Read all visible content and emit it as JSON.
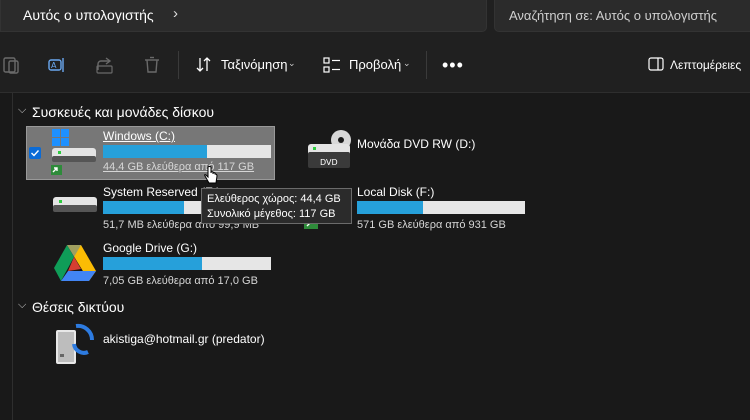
{
  "address": {
    "breadcrumb": "Αυτός ο υπολογιστής",
    "chevron": "›"
  },
  "search": {
    "placeholder": "Αναζήτηση σε: Αυτός ο υπολογιστής"
  },
  "toolbar": {
    "sort_label": "Ταξινόμηση",
    "view_label": "Προβολή",
    "more_label": "•••",
    "details_label": "Λεπτομέρειες"
  },
  "groups": {
    "devices": "Συσκευές και μονάδες δίσκου",
    "network": "Θέσεις δικτύου"
  },
  "drives": [
    {
      "name": "Windows (C:)",
      "info": "44,4 GB ελεύθερα από 117 GB",
      "used_fraction": 0.62,
      "selected": true
    },
    {
      "name": "System Reserved (E:)",
      "info": "51,7 MB ελεύθερα από 99,9 MB",
      "used_fraction": 0.48
    },
    {
      "name": "Google Drive (G:)",
      "info": "7,05 GB ελεύθερα από 17,0 GB",
      "used_fraction": 0.59
    },
    {
      "name": "Μονάδα DVD RW (D:)"
    },
    {
      "name": "Local Disk (F:)",
      "info": "571 GB ελεύθερα από 931 GB",
      "used_fraction": 0.39
    }
  ],
  "dvd_badge": "DVD",
  "network_locations": [
    {
      "name": "akistiga@hotmail.gr (predator)"
    }
  ],
  "tooltip": {
    "line1": "Ελεύθερος χώρος: 44,4 GB",
    "line2": "Συνολικό μέγεθος: 117 GB"
  },
  "colors": {
    "accent": "#26a0da",
    "selection": "#777777",
    "background": "#191919"
  }
}
